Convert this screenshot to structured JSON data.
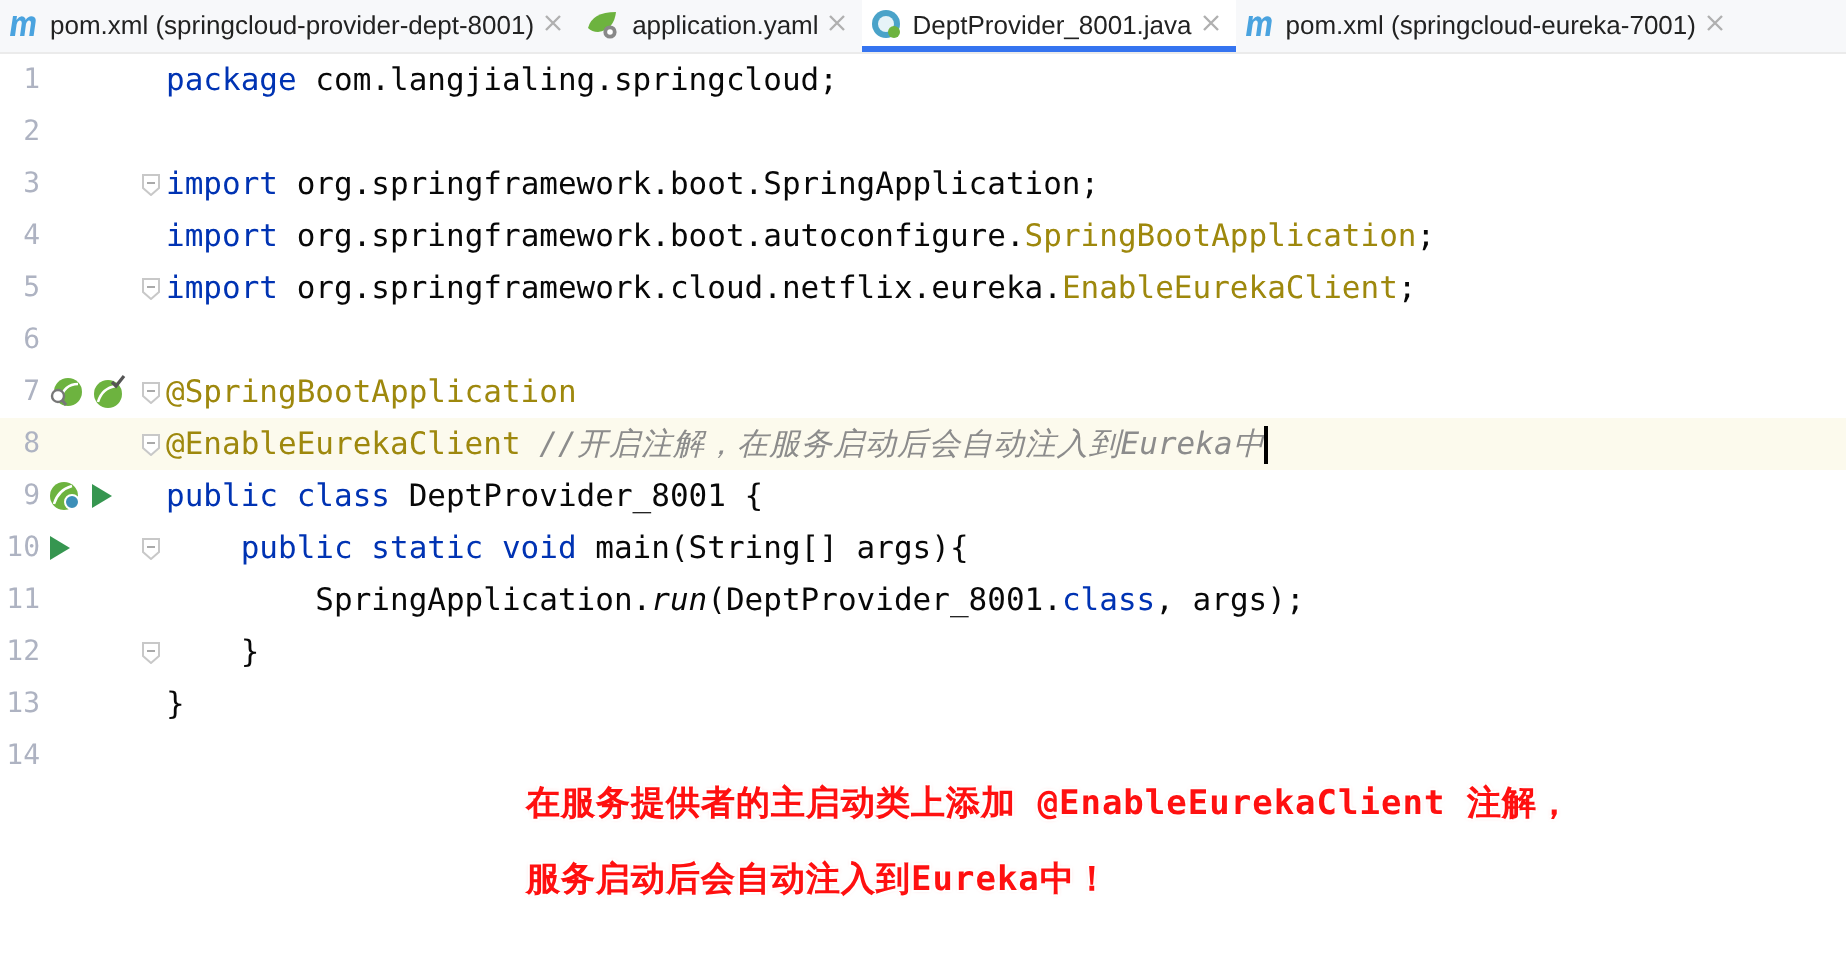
{
  "tabs": [
    {
      "label": "pom.xml (springcloud-provider-dept-8001)",
      "kind": "maven",
      "selected": false
    },
    {
      "label": "application.yaml",
      "kind": "yaml",
      "selected": false
    },
    {
      "label": "DeptProvider_8001.java",
      "kind": "java",
      "selected": true
    },
    {
      "label": "pom.xml (springcloud-eureka-7001)",
      "kind": "maven",
      "selected": false
    }
  ],
  "lines": [
    {
      "number": "1",
      "fold": false,
      "current": false,
      "tokens": [
        {
          "kind": "keyword",
          "text": "package"
        },
        {
          "kind": "plain",
          "text": " com.langjialing.springcloud;"
        }
      ]
    },
    {
      "number": "2",
      "fold": false,
      "current": false
    },
    {
      "number": "3",
      "fold": true,
      "current": false,
      "tokens": [
        {
          "kind": "keyword",
          "text": "import"
        },
        {
          "kind": "plain",
          "text": " org.springframework.boot.SpringApplication;"
        }
      ]
    },
    {
      "number": "4",
      "fold": false,
      "current": false,
      "tokens": [
        {
          "kind": "keyword",
          "text": "import"
        },
        {
          "kind": "plain",
          "text": " org.springframework.boot.autoconfigure."
        },
        {
          "kind": "annotation",
          "text": "SpringBootApplication"
        },
        {
          "kind": "plain",
          "text": ";"
        }
      ]
    },
    {
      "number": "5",
      "fold": true,
      "current": false,
      "tokens": [
        {
          "kind": "keyword",
          "text": "import"
        },
        {
          "kind": "plain",
          "text": " org.springframework.cloud.netflix.eureka."
        },
        {
          "kind": "annotation",
          "text": "EnableEurekaClient"
        },
        {
          "kind": "plain",
          "text": ";"
        }
      ]
    },
    {
      "number": "6",
      "fold": false,
      "current": false
    },
    {
      "number": "7",
      "fold": true,
      "current": false,
      "gutter": [
        {
          "kind": "bean-search"
        },
        {
          "kind": "bean-check"
        }
      ],
      "tokens": [
        {
          "kind": "annotation",
          "text": "@SpringBootApplication"
        }
      ]
    },
    {
      "number": "8",
      "fold": true,
      "current": true,
      "tokens": [
        {
          "kind": "annotation",
          "text": "@EnableEurekaClient"
        },
        {
          "kind": "comment",
          "text": "//开启注解，在服务启动后会自动注入到Eureka中"
        }
      ]
    },
    {
      "number": "9",
      "fold": false,
      "current": false,
      "gutter": [
        {
          "kind": "bean-run"
        },
        {
          "kind": "run"
        }
      ],
      "tokens": [
        {
          "kind": "keyword",
          "text": "public class"
        },
        {
          "kind": "plain",
          "text": " DeptProvider_8001 {"
        }
      ]
    },
    {
      "number": "10",
      "fold": true,
      "current": false,
      "gutter": [
        {
          "kind": "run"
        }
      ],
      "tokens": [
        {
          "kind": "keyword",
          "text": "    public static void"
        },
        {
          "kind": "plain",
          "text": " main(String[] args){"
        }
      ]
    },
    {
      "number": "11",
      "fold": false,
      "current": false,
      "tokens": [
        {
          "kind": "plain",
          "text": "        SpringApplication."
        },
        {
          "kind": "static-call",
          "text": "run"
        },
        {
          "kind": "plain",
          "text": "(DeptProvider_8001."
        },
        {
          "kind": "keyword",
          "text": "class"
        },
        {
          "kind": "plain",
          "text": ", args);"
        }
      ]
    },
    {
      "number": "12",
      "fold": true,
      "current": false,
      "tokens": [
        {
          "kind": "plain",
          "text": "    }"
        }
      ]
    },
    {
      "number": "13",
      "fold": false,
      "current": false,
      "tokens": [
        {
          "kind": "plain",
          "text": "}"
        }
      ]
    },
    {
      "number": "14",
      "fold": false,
      "current": false
    }
  ],
  "note": [
    "在服务提供者的主启动类上添加 @EnableEurekaClient 注解，",
    "服务启动后会自动注入到Eureka中！"
  ]
}
